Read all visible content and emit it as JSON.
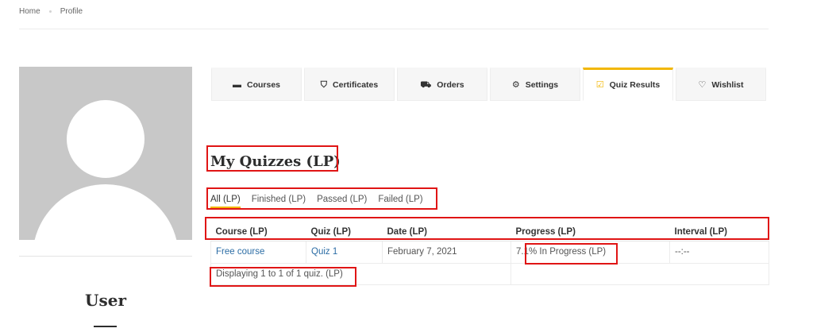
{
  "breadcrumb": {
    "home": "Home",
    "current": "Profile"
  },
  "profile": {
    "name": "User"
  },
  "tabs": [
    {
      "label": "Courses",
      "icon": "book-icon",
      "glyph": "▬",
      "active": false
    },
    {
      "label": "Certificates",
      "icon": "bookmark-icon",
      "glyph": "⛉",
      "active": false
    },
    {
      "label": "Orders",
      "icon": "cart-icon",
      "glyph": "⛟",
      "active": false
    },
    {
      "label": "Settings",
      "icon": "gear-icon",
      "glyph": "⚙",
      "active": false
    },
    {
      "label": "Quiz Results",
      "icon": "check-square-icon",
      "glyph": "☑",
      "active": true
    },
    {
      "label": "Wishlist",
      "icon": "heart-icon",
      "glyph": "♡",
      "active": false
    }
  ],
  "main": {
    "title": "My Quizzes (LP)",
    "filters": [
      "All (LP)",
      "Finished (LP)",
      "Passed (LP)",
      "Failed (LP)"
    ],
    "active_filter": "All (LP)",
    "table": {
      "headers": [
        "Course (LP)",
        "Quiz (LP)",
        "Date (LP)",
        "Progress (LP)",
        "Interval (LP)"
      ],
      "rows": [
        {
          "course": "Free course",
          "quiz": "Quiz 1",
          "date": "February 7, 2021",
          "progress": "7.1% In Progress (LP)",
          "interval": "--:--"
        }
      ],
      "footer": "Displaying 1 to 1 of 1 quiz. (LP)"
    }
  },
  "colors": {
    "accent": "#f2b705",
    "link": "#2c6da5",
    "highlight": "#e01515"
  }
}
